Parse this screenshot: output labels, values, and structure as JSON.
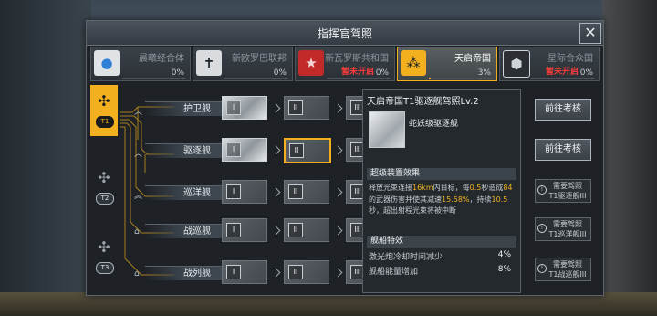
{
  "window": {
    "title": "指挥官驾照",
    "close_icon": "close-icon"
  },
  "factions": [
    {
      "name": "晨曦经合体",
      "percent": "0%",
      "status": "",
      "progress": 0,
      "icon": "sphere-icon",
      "color": "#2f7fd6"
    },
    {
      "name": "新欧罗巴联邦",
      "percent": "0%",
      "status": "",
      "progress": 0,
      "icon": "cross-icon",
      "color": "#d9dcdf"
    },
    {
      "name": "新瓦罗斯共和国",
      "percent": "0%",
      "status": "暂未开启",
      "progress": 0,
      "icon": "star-icon",
      "color": "#c22a2a"
    },
    {
      "name": "天启帝国",
      "percent": "3%",
      "status": "",
      "progress": 0.03,
      "icon": "cluster-icon",
      "color": "#f2b01e",
      "active": true
    },
    {
      "name": "星际合众国",
      "percent": "0%",
      "status": "暂未开启",
      "progress": 0,
      "icon": "hex-icon",
      "color": "#cfd4d8"
    }
  ],
  "tiers": [
    {
      "label": "T1",
      "icon": "ship-tier-icon",
      "active": true
    },
    {
      "label": "T2",
      "icon": "ship-tier-icon"
    },
    {
      "label": "T3",
      "icon": "ship-tier-icon"
    }
  ],
  "ship_rows": [
    {
      "name": "护卫舰",
      "cards": [
        {
          "level": "I",
          "state": "owned"
        },
        {
          "level": "II",
          "state": "locked"
        },
        {
          "level": "III",
          "state": "locked"
        }
      ]
    },
    {
      "name": "驱逐舰",
      "cards": [
        {
          "level": "I",
          "state": "owned"
        },
        {
          "level": "II",
          "state": "selected"
        },
        {
          "level": "III",
          "state": "locked"
        }
      ]
    },
    {
      "name": "巡洋舰",
      "cards": [
        {
          "level": "I",
          "state": "locked"
        },
        {
          "level": "II",
          "state": "locked"
        },
        {
          "level": "III",
          "state": "locked"
        }
      ]
    },
    {
      "name": "战巡舰",
      "cards": [
        {
          "level": "I",
          "state": "locked"
        },
        {
          "level": "II",
          "state": "locked"
        },
        {
          "level": "III",
          "state": "locked"
        }
      ]
    },
    {
      "name": "战列舰",
      "cards": [
        {
          "level": "I",
          "state": "locked"
        },
        {
          "level": "II",
          "state": "locked"
        },
        {
          "level": "III",
          "state": "locked"
        }
      ]
    }
  ],
  "detail": {
    "title": "天启帝国T1驱逐舰驾照Lv.2",
    "ship_name": "蛇妖级驱逐舰",
    "effect_header": "超级装置效果",
    "effect_text": [
      "释放光束连接",
      "16km",
      "内目标，每",
      "0.5",
      "秒造成",
      "84",
      "的武器伤害并使其减速",
      "15.58%",
      "，持续",
      "10.5",
      "秒，超出射程光束将被中断"
    ],
    "traits_header": "舰船特效",
    "stats": [
      {
        "label": "激光炮冷却时间减少",
        "value": "4%"
      },
      {
        "label": "舰船能量增加",
        "value": "8%"
      }
    ]
  },
  "actions": [
    {
      "type": "button",
      "label": "前往考核"
    },
    {
      "type": "button",
      "label": "前往考核"
    },
    {
      "type": "requirement",
      "line1": "需要驾照",
      "line2": "T1驱逐舰III"
    },
    {
      "type": "requirement",
      "line1": "需要驾照",
      "line2": "T1巡洋舰III"
    },
    {
      "type": "requirement",
      "line1": "需要驾照",
      "line2": "T1战巡舰III"
    }
  ],
  "colors": {
    "accent": "#f2b01e",
    "panel": "#1e2227",
    "warning": "#ff3c3c"
  }
}
